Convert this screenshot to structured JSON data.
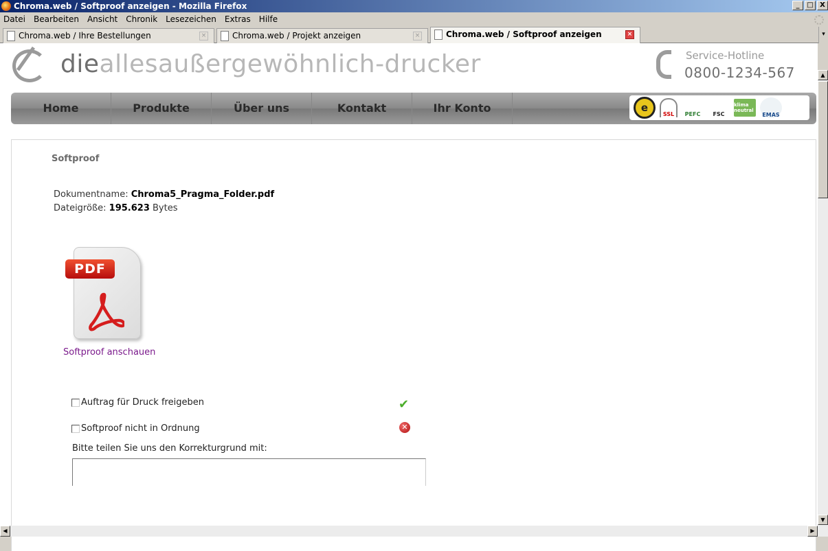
{
  "window": {
    "title": "Chroma.web / Softproof anzeigen - Mozilla Firefox",
    "buttons": [
      "_",
      "□",
      "X"
    ]
  },
  "menu": {
    "items": [
      {
        "label": "Datei",
        "accel": "D"
      },
      {
        "label": "Bearbeiten",
        "accel": "B"
      },
      {
        "label": "Ansicht",
        "accel": "A"
      },
      {
        "label": "Chronik",
        "accel": "C"
      },
      {
        "label": "Lesezeichen",
        "accel": "L"
      },
      {
        "label": "Extras",
        "accel": "x"
      },
      {
        "label": "Hilfe",
        "accel": "H"
      }
    ]
  },
  "tabs": [
    {
      "label": "Chroma.web / Ihre Bestellungen",
      "active": false
    },
    {
      "label": "Chroma.web / Projekt anzeigen",
      "active": false
    },
    {
      "label": "Chroma.web / Softproof anzeigen",
      "active": true
    }
  ],
  "header": {
    "brand_prefix": "die",
    "brand_rest": "allesaußergewöhnlich-drucker",
    "hotline_label": "Service-Hotline",
    "hotline_number": "0800-1234-567"
  },
  "nav": {
    "items": [
      "Home",
      "Produkte",
      "Über uns",
      "Kontakt",
      "Ihr Konto"
    ]
  },
  "badges": {
    "trusted": "e",
    "ssl": "SSL",
    "pefc": "PEFC",
    "fsc": "FSC",
    "klima": "klima neutral",
    "emas": "EMAS"
  },
  "content": {
    "heading": "Softproof",
    "docname_label": "Dokumentname: ",
    "docname_value": "Chroma5_Pragma_Folder.pdf",
    "filesize_label": "Dateigröße: ",
    "filesize_value": "195.623",
    "filesize_unit": " Bytes",
    "pdf_label": "PDF",
    "view_link": "Softproof anschauen",
    "approve_label": "Auftrag für Druck freigeben",
    "reject_label": "Softproof nicht in Ordnung",
    "reason_label": "Bitte teilen Sie uns den Korrekturgrund mit:",
    "reason_value": ""
  }
}
